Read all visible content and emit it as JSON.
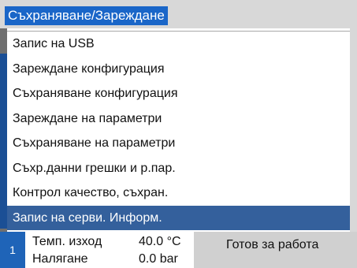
{
  "header": {
    "title": "Съхраняване/Зареждане"
  },
  "menu": {
    "items": [
      {
        "label": "Запис на USB"
      },
      {
        "label": "Зареждане конфигурация"
      },
      {
        "label": "Съхраняване конфигурация"
      },
      {
        "label": "Зареждане на параметри"
      },
      {
        "label": "Съхраняване на параметри"
      },
      {
        "label": "Съхр.данни грешки и р.пар."
      },
      {
        "label": "Контрол качество, съхран."
      },
      {
        "label": "Запис на серви. Информ."
      }
    ],
    "selected_index": 7
  },
  "status": {
    "page_number": "1",
    "temp_label": "Темп. изход",
    "temp_value": "40.0 °C",
    "pressure_label": "Налягане",
    "pressure_value": "0.0 bar",
    "state_text": "Готов за работа"
  },
  "colors": {
    "header_highlight": "#1a66c8",
    "selection": "#34609c",
    "side_accent": "#1b4f95",
    "panel_gray": "#d0d0d0"
  }
}
